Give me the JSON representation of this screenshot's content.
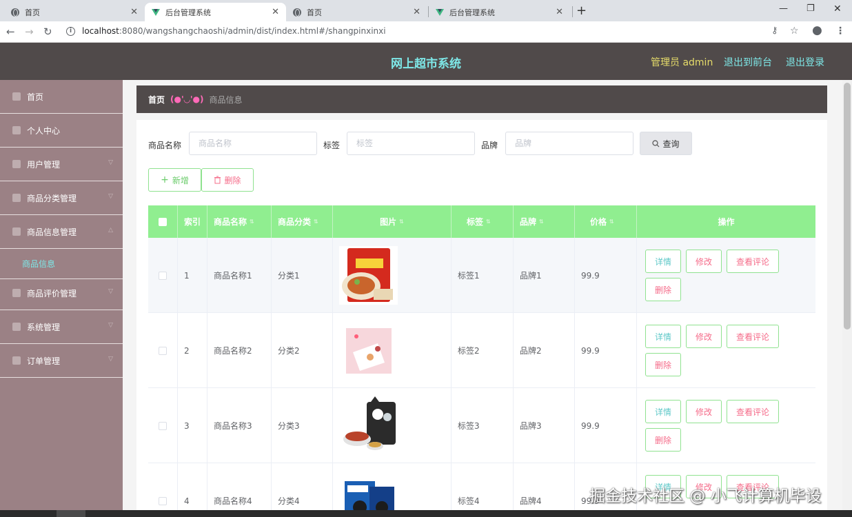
{
  "browser": {
    "tabs": [
      {
        "title": "首页",
        "icon": "globe-icon",
        "active": false
      },
      {
        "title": "后台管理系统",
        "icon": "vue-logo-icon",
        "active": true
      },
      {
        "title": "首页",
        "icon": "globe-icon",
        "active": false
      },
      {
        "title": "后台管理系统",
        "icon": "vue-logo-icon",
        "active": false
      }
    ],
    "url_host": "localhost",
    "url_path": ":8080/wangshangchaoshi/admin/dist/index.html#/shangpinxinxi"
  },
  "header": {
    "title": "网上超市系统",
    "user": "管理员 admin",
    "link_front": "退出到前台",
    "link_logout": "退出登录"
  },
  "sidebar": {
    "items": [
      {
        "label": "首页"
      },
      {
        "label": "个人中心"
      },
      {
        "label": "用户管理"
      },
      {
        "label": "商品分类管理"
      },
      {
        "label": "商品信息管理"
      },
      {
        "label": "商品信息"
      },
      {
        "label": "商品评价管理"
      },
      {
        "label": "系统管理"
      },
      {
        "label": "订单管理"
      }
    ]
  },
  "breadcrumb": {
    "home": "首页",
    "separator": "(●'◡'●)",
    "current": "商品信息"
  },
  "filters": {
    "name_label": "商品名称",
    "name_placeholder": "商品名称",
    "tag_label": "标签",
    "tag_placeholder": "标签",
    "brand_label": "品牌",
    "brand_placeholder": "品牌",
    "query_button": "查询"
  },
  "actions": {
    "add_button": "新增",
    "delete_button": "删除"
  },
  "table": {
    "columns": [
      "索引",
      "商品名称",
      "商品分类",
      "图片",
      "标签",
      "品牌",
      "价格",
      "操作"
    ],
    "rows": [
      {
        "index": "1",
        "name": "商品名称1",
        "category": "分类1",
        "tag": "标签1",
        "brand": "品牌1",
        "price": "99.9"
      },
      {
        "index": "2",
        "name": "商品名称2",
        "category": "分类2",
        "tag": "标签2",
        "brand": "品牌2",
        "price": "99.9"
      },
      {
        "index": "3",
        "name": "商品名称3",
        "category": "分类3",
        "tag": "标签3",
        "brand": "品牌3",
        "price": "99.9"
      },
      {
        "index": "4",
        "name": "商品名称4",
        "category": "分类4",
        "tag": "标签4",
        "brand": "品牌4",
        "price": "99.9"
      }
    ],
    "op_labels": {
      "detail": "详情",
      "edit": "修改",
      "review": "查看评论",
      "delete": "删除"
    }
  },
  "watermark": "掘金技术社区 @ 小飞计算机毕设",
  "colors": {
    "header_bg": "#504a4a",
    "sidebar_bg": "#9b8185",
    "table_header": "#90ee90",
    "accent_cyan": "#7ee8e8",
    "accent_pink": "#f56c8a"
  }
}
